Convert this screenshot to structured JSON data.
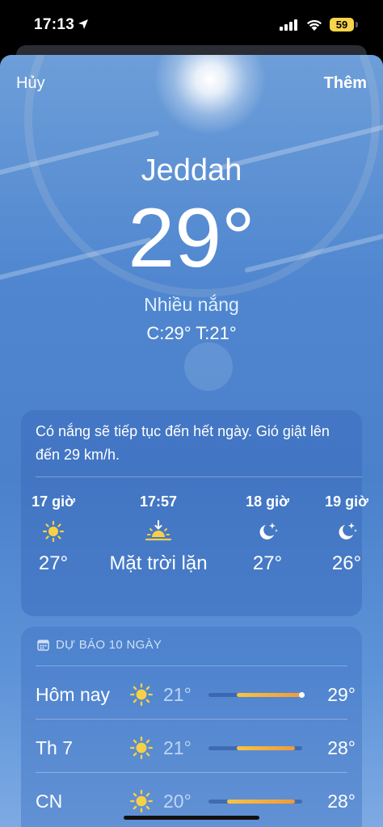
{
  "status": {
    "time": "17:13",
    "battery": "59"
  },
  "nav": {
    "cancel": "Hủy",
    "add": "Thêm"
  },
  "current": {
    "city": "Jeddah",
    "temp": "29°",
    "condition": "Nhiều nắng",
    "hilo": "C:29°  T:21°"
  },
  "hourly": {
    "summary": "Có nắng sẽ tiếp tục đến hết ngày. Gió giật lên đến 29 km/h.",
    "items": [
      {
        "label": "17 giờ",
        "icon": "sun-icon",
        "temp": "27°"
      },
      {
        "label": "17:57",
        "icon": "sunset-icon",
        "temp": "Mặt trời lặn"
      },
      {
        "label": "18 giờ",
        "icon": "moon-stars-icon",
        "temp": "27°"
      },
      {
        "label": "19 giờ",
        "icon": "moon-stars-icon",
        "temp": "26°"
      }
    ]
  },
  "forecast": {
    "header": "DỰ BÁO 10 NGÀY",
    "rows": [
      {
        "day": "Hôm nay",
        "icon": "sun-icon",
        "low": "21°",
        "high": "29°",
        "range_start": 0.3,
        "range_end": 1.0,
        "current": 1.0
      },
      {
        "day": "Th 7",
        "icon": "sun-icon",
        "low": "21°",
        "high": "28°",
        "range_start": 0.3,
        "range_end": 0.92
      },
      {
        "day": "CN",
        "icon": "sun-icon",
        "low": "20°",
        "high": "28°",
        "range_start": 0.2,
        "range_end": 0.92
      }
    ]
  },
  "colors": {
    "battery": "#f7d44a",
    "bar_start": "#f5c542",
    "bar_end": "#f09a3a"
  }
}
